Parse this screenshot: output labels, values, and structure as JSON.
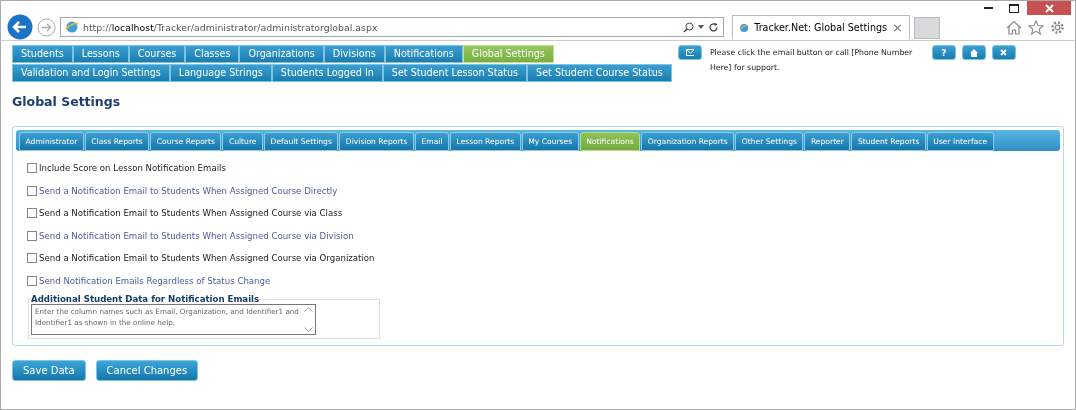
{
  "browser": {
    "url_host": "localhost",
    "url_prefix": "http://",
    "url_path": "/Tracker/administrator/administratorglobal.aspx",
    "tab_title": "Tracker.Net: Global Settings",
    "tab_close": "×"
  },
  "main_nav": {
    "primary": [
      {
        "label": "Students",
        "selected": false
      },
      {
        "label": "Lessons",
        "selected": false
      },
      {
        "label": "Courses",
        "selected": false
      },
      {
        "label": "Classes",
        "selected": false
      },
      {
        "label": "Organizations",
        "selected": false
      },
      {
        "label": "Divisions",
        "selected": false
      },
      {
        "label": "Notifications",
        "selected": false
      },
      {
        "label": "Global Settings",
        "selected": true
      }
    ],
    "secondary": [
      {
        "label": "Validation and Login Settings",
        "selected": false
      },
      {
        "label": "Language Strings",
        "selected": false
      },
      {
        "label": "Students Logged In",
        "selected": false
      },
      {
        "label": "Set Student Lesson Status",
        "selected": false
      },
      {
        "label": "Set Student Course Status",
        "selected": false
      }
    ]
  },
  "support": {
    "text": "Please click the email button or call [Phone Number Here] for support.",
    "help_button": "?"
  },
  "page_title": "Global Settings",
  "settings_tabs": [
    {
      "label": "Administrator",
      "selected": false
    },
    {
      "label": "Class Reports",
      "selected": false
    },
    {
      "label": "Course Reports",
      "selected": false
    },
    {
      "label": "Culture",
      "selected": false
    },
    {
      "label": "Default Settings",
      "selected": false
    },
    {
      "label": "Division Reports",
      "selected": false
    },
    {
      "label": "Email",
      "selected": false
    },
    {
      "label": "Lesson Reports",
      "selected": false
    },
    {
      "label": "My Courses",
      "selected": false
    },
    {
      "label": "Notifications",
      "selected": true
    },
    {
      "label": "Organization Reports",
      "selected": false
    },
    {
      "label": "Other Settings",
      "selected": false
    },
    {
      "label": "Reporter",
      "selected": false
    },
    {
      "label": "Student Reports",
      "selected": false
    },
    {
      "label": "User Interface",
      "selected": false
    }
  ],
  "options": [
    {
      "label": "Include Score on Lesson Notification Emails",
      "checked": false,
      "alternate": false
    },
    {
      "label": "Send a Notification Email to Students When Assigned Course Directly",
      "checked": false,
      "alternate": true
    },
    {
      "label": "Send a Notification Email to Students When Assigned Course via Class",
      "checked": false,
      "alternate": false
    },
    {
      "label": "Send a Notification Email to Students When Assigned Course via Division",
      "checked": false,
      "alternate": true
    },
    {
      "label": "Send a Notification Email to Students When Assigned Course via Organization",
      "checked": false,
      "alternate": false
    },
    {
      "label": "Send Notification Emails Regardless of Status Change",
      "checked": false,
      "alternate": true
    }
  ],
  "additional_data": {
    "legend": "Additional Student Data for Notification Emails",
    "placeholder": "Enter the column names such as Email, Organization, and Identifier1 and Identifier1 as shown in the online help."
  },
  "buttons": [
    "Save Data",
    "Cancel Changes"
  ]
}
